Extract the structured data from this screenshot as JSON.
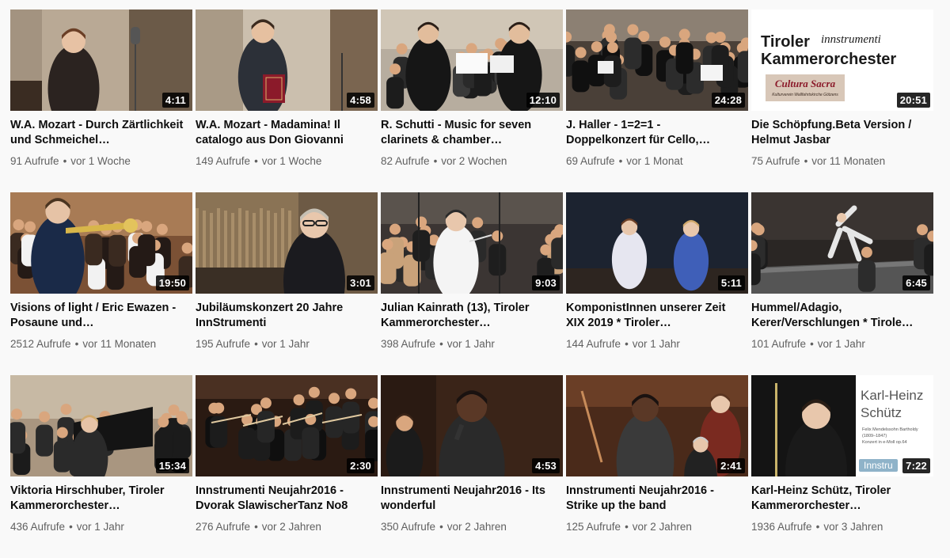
{
  "videos": [
    {
      "title": "W.A. Mozart - Durch Zärtlichkeit und Schmeichel…",
      "views": "91 Aufrufe",
      "age": "vor 1 Woche",
      "duration": "4:11",
      "thumb": "t1"
    },
    {
      "title": "W.A. Mozart - Madamina! Il catalogo aus Don Giovanni",
      "views": "149 Aufrufe",
      "age": "vor 1 Woche",
      "duration": "4:58",
      "thumb": "t2"
    },
    {
      "title": "R. Schutti - Music for seven clarinets & chamber…",
      "views": "82 Aufrufe",
      "age": "vor 2 Wochen",
      "duration": "12:10",
      "thumb": "t3"
    },
    {
      "title": "J. Haller - 1=2=1 - Doppelkonzert für Cello,…",
      "views": "69 Aufrufe",
      "age": "vor 1 Monat",
      "duration": "24:28",
      "thumb": "t4"
    },
    {
      "title": "Die Schöpfung.Beta Version / Helmut Jasbar",
      "views": "75 Aufrufe",
      "age": "vor 11 Monaten",
      "duration": "20:51",
      "thumb": "t5"
    },
    {
      "title": "Visions of light / Eric Ewazen - Posaune und…",
      "views": "2512 Aufrufe",
      "age": "vor 11 Monaten",
      "duration": "19:50",
      "thumb": "t6"
    },
    {
      "title": "Jubiläumskonzert 20 Jahre InnStrumenti",
      "views": "195 Aufrufe",
      "age": "vor 1 Jahr",
      "duration": "3:01",
      "thumb": "t7"
    },
    {
      "title": "Julian Kainrath (13), Tiroler Kammerorchester…",
      "views": "398 Aufrufe",
      "age": "vor 1 Jahr",
      "duration": "9:03",
      "thumb": "t8"
    },
    {
      "title": "KomponistInnen unserer Zeit XIX 2019 * Tiroler…",
      "views": "144 Aufrufe",
      "age": "vor 1 Jahr",
      "duration": "5:11",
      "thumb": "t9"
    },
    {
      "title": "Hummel/Adagio, Kerer/Verschlungen * Tirole…",
      "views": "101 Aufrufe",
      "age": "vor 1 Jahr",
      "duration": "6:45",
      "thumb": "t10"
    },
    {
      "title": "Viktoria Hirschhuber, Tiroler Kammerorchester…",
      "views": "436 Aufrufe",
      "age": "vor 1 Jahr",
      "duration": "15:34",
      "thumb": "t11"
    },
    {
      "title": "Innstrumenti Neujahr2016 - Dvorak SlawischerTanz No8",
      "views": "276 Aufrufe",
      "age": "vor 2 Jahren",
      "duration": "2:30",
      "thumb": "t12"
    },
    {
      "title": "Innstrumenti Neujahr2016 - Its wonderful",
      "views": "350 Aufrufe",
      "age": "vor 2 Jahren",
      "duration": "4:53",
      "thumb": "t13"
    },
    {
      "title": "Innstrumenti Neujahr2016 - Strike up the band",
      "views": "125 Aufrufe",
      "age": "vor 2 Jahren",
      "duration": "2:41",
      "thumb": "t14"
    },
    {
      "title": "Karl-Heinz Schütz, Tiroler Kammerorchester…",
      "views": "1936 Aufrufe",
      "age": "vor 3 Jahren",
      "duration": "7:22",
      "thumb": "t15"
    }
  ],
  "thumb_text": {
    "t5": {
      "line1": "Tiroler",
      "line2": "Kammerorchester",
      "logo": "innstrumenti",
      "badge": "Cultura Sacra",
      "badge_sub": "Kulturverein Wallfahrtskirche Götzens"
    },
    "t15": {
      "name1": "Karl-Heinz",
      "name2": "Schütz",
      "small1": "Felix Mendelssohn Bartholdy",
      "small2": "(1809–1847)",
      "small3": "Konzert in e-Moll op.64",
      "logo": "Innstru"
    }
  },
  "colors": {
    "background": "#f9f9f9",
    "title": "#0d0d0d",
    "meta": "#606060",
    "duration_bg": "#000000"
  }
}
